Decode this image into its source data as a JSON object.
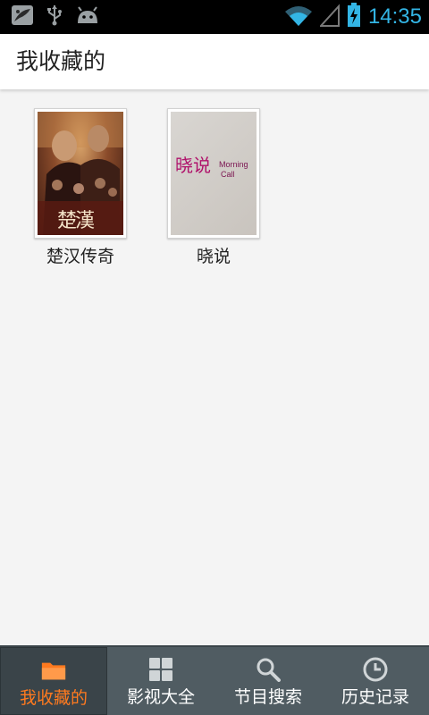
{
  "status_bar": {
    "time": "14:35",
    "icons": [
      "app-notification-icon",
      "usb-icon",
      "android-debug-icon",
      "wifi-icon",
      "signal-icon",
      "battery-charging-icon"
    ]
  },
  "header": {
    "title": "我收藏的"
  },
  "favorites": [
    {
      "title": "楚汉传奇",
      "poster": "chuhan-poster"
    },
    {
      "title": "晓说",
      "poster": "xiaoshuo-poster"
    }
  ],
  "poster_text": {
    "chuhan": "楚漢",
    "xiaoshuo_main": "晓说",
    "xiaoshuo_sub_1": "Morning",
    "xiaoshuo_sub_2": "Call"
  },
  "bottom_nav": {
    "items": [
      {
        "label": "我收藏的",
        "icon": "folder-icon",
        "active": true
      },
      {
        "label": "影视大全",
        "icon": "grid-icon",
        "active": false
      },
      {
        "label": "节目搜索",
        "icon": "search-icon",
        "active": false
      },
      {
        "label": "历史记录",
        "icon": "clock-icon",
        "active": false
      }
    ]
  },
  "colors": {
    "accent": "#33b5e5",
    "active_tab": "#ff7a1f",
    "nav_bg": "#505c62"
  }
}
